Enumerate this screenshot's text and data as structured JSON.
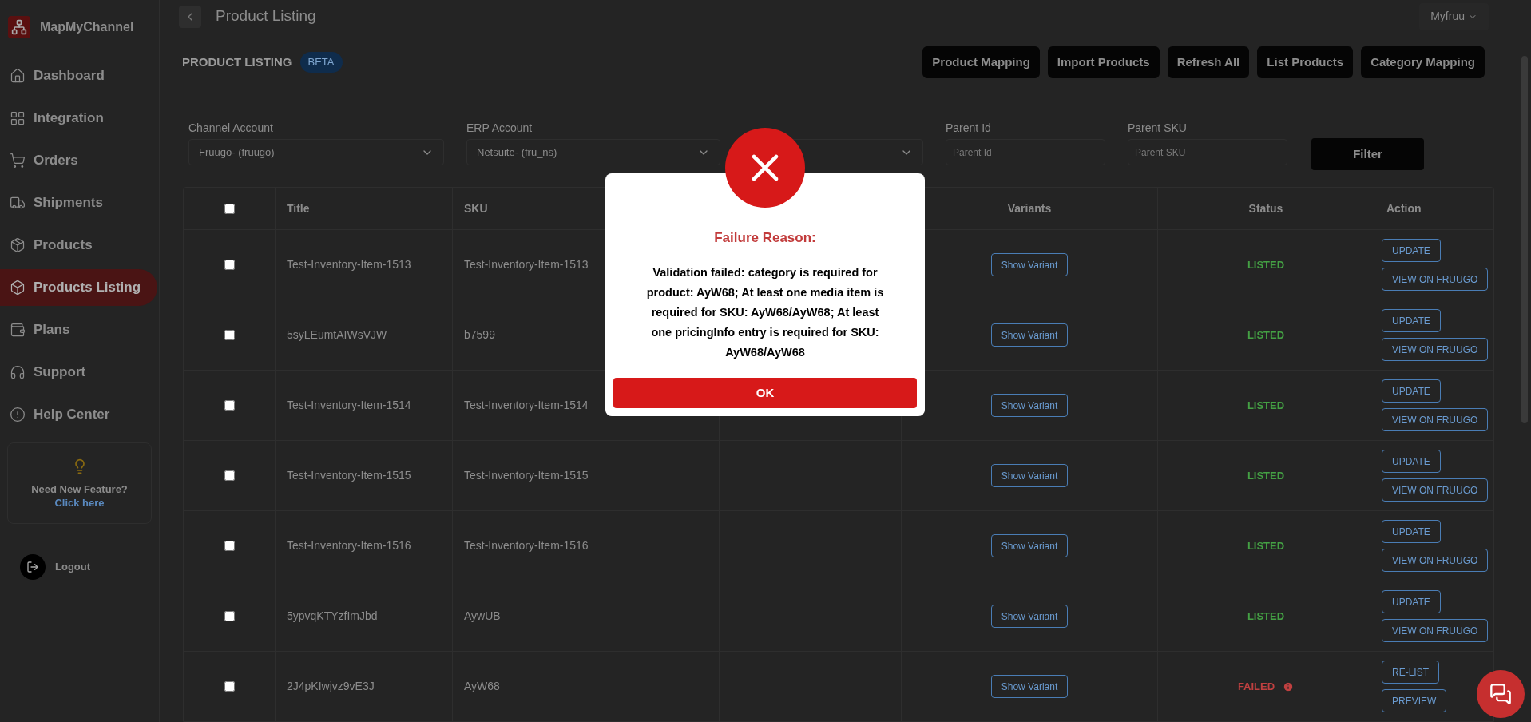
{
  "app": {
    "name": "MapMyChannel"
  },
  "sidebar": {
    "items": [
      {
        "label": "Dashboard",
        "selected": false
      },
      {
        "label": "Integration",
        "selected": false
      },
      {
        "label": "Orders",
        "selected": false
      },
      {
        "label": "Shipments",
        "selected": false
      },
      {
        "label": "Products",
        "selected": false
      },
      {
        "label": "Products Listing",
        "selected": true
      },
      {
        "label": "Plans",
        "selected": false
      },
      {
        "label": "Support",
        "selected": false
      },
      {
        "label": "Help Center",
        "selected": false
      }
    ],
    "feature_card": {
      "title": "Need New Feature?",
      "link": "Click here"
    },
    "logout": "Logout"
  },
  "header": {
    "title": "Product Listing",
    "account_menu": "Myfruu"
  },
  "page": {
    "heading": "PRODUCT LISTING",
    "badge": "BETA",
    "actions": [
      "Product Mapping",
      "Import Products",
      "Refresh All",
      "List Products",
      "Category Mapping"
    ]
  },
  "filters": [
    {
      "kind": "select",
      "label": "Channel Account",
      "value": "Fruugo- (fruugo)"
    },
    {
      "kind": "select",
      "label": "ERP Account",
      "value": "Netsuite- (fru_ns)"
    },
    {
      "kind": "select"
    },
    {
      "kind": "input",
      "label": "Parent Id",
      "placeholder": "Parent Id"
    },
    {
      "kind": "input",
      "label": "Parent SKU",
      "placeholder": "Parent SKU"
    }
  ],
  "filter_button": "Filter",
  "table": {
    "header_checkbox": {
      "checked": false
    },
    "columns": [
      "Title",
      "SKU",
      "Variants",
      "Status",
      "Action"
    ],
    "rows": [
      {
        "checked": false,
        "title": "Test-Inventory-Item-1513",
        "sku": "Test-Inventory-Item-1513",
        "variants": "Show Variant",
        "status": "LISTED",
        "kind": "listed",
        "actions": [
          "UPDATE",
          "VIEW ON FRUUGO"
        ]
      },
      {
        "checked": false,
        "title": "5syLEumtAIWsVJW",
        "sku": "b7599",
        "variants": "Show Variant",
        "status": "LISTED",
        "kind": "listed",
        "actions": [
          "UPDATE",
          "VIEW ON FRUUGO"
        ]
      },
      {
        "checked": false,
        "title": "Test-Inventory-Item-1514",
        "sku": "Test-Inventory-Item-1514",
        "variants": "Show Variant",
        "status": "LISTED",
        "kind": "listed",
        "actions": [
          "UPDATE",
          "VIEW ON FRUUGO"
        ]
      },
      {
        "checked": false,
        "title": "Test-Inventory-Item-1515",
        "sku": "Test-Inventory-Item-1515",
        "variants": "Show Variant",
        "status": "LISTED",
        "kind": "listed",
        "actions": [
          "UPDATE",
          "VIEW ON FRUUGO"
        ]
      },
      {
        "checked": false,
        "title": "Test-Inventory-Item-1516",
        "sku": "Test-Inventory-Item-1516",
        "variants": "Show Variant",
        "status": "LISTED",
        "kind": "listed",
        "actions": [
          "UPDATE",
          "VIEW ON FRUUGO"
        ]
      },
      {
        "checked": false,
        "title": "5ypvqKTYzfImJbd",
        "sku": "AywUB",
        "variants": "Show Variant",
        "status": "LISTED",
        "kind": "listed",
        "actions": [
          "UPDATE",
          "VIEW ON FRUUGO"
        ]
      },
      {
        "checked": false,
        "title": "2J4pKIwjvz9vE3J",
        "sku": "AyW68",
        "variants": "Show Variant",
        "status": "FAILED",
        "kind": "failed",
        "actions": [
          "RE-LIST",
          "PREVIEW"
        ]
      }
    ]
  },
  "modal": {
    "title": "Failure Reason:",
    "message": "Validation failed: category is required for product: AyW68; At least one media item is required for SKU: AyW68/AyW68; At least one pricingInfo entry is required for SKU: AyW68/AyW68",
    "button": "OK"
  }
}
